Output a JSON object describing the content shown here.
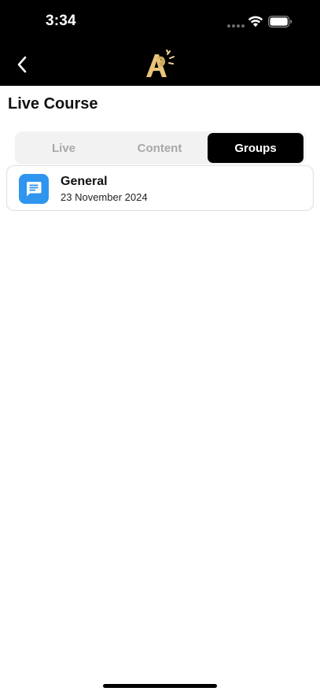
{
  "status_bar": {
    "time": "3:34"
  },
  "nav": {
    "logo": "stylized-a-logo-icon",
    "back": "chevron-left-icon"
  },
  "page": {
    "title": "Live Course"
  },
  "tabs": [
    {
      "label": "Live",
      "selected": false
    },
    {
      "label": "Content",
      "selected": false
    },
    {
      "label": "Groups",
      "selected": true
    }
  ],
  "groups": [
    {
      "name": "General",
      "date": "23 November 2024",
      "icon": "chat-bubble-icon"
    }
  ],
  "colors": {
    "header_bg": "#000000",
    "tab_selected_bg": "#000000",
    "tab_inactive_text": "#a8a8a8",
    "group_icon_bg": "#2f95ef",
    "logo_gold": "#e8c47a"
  }
}
